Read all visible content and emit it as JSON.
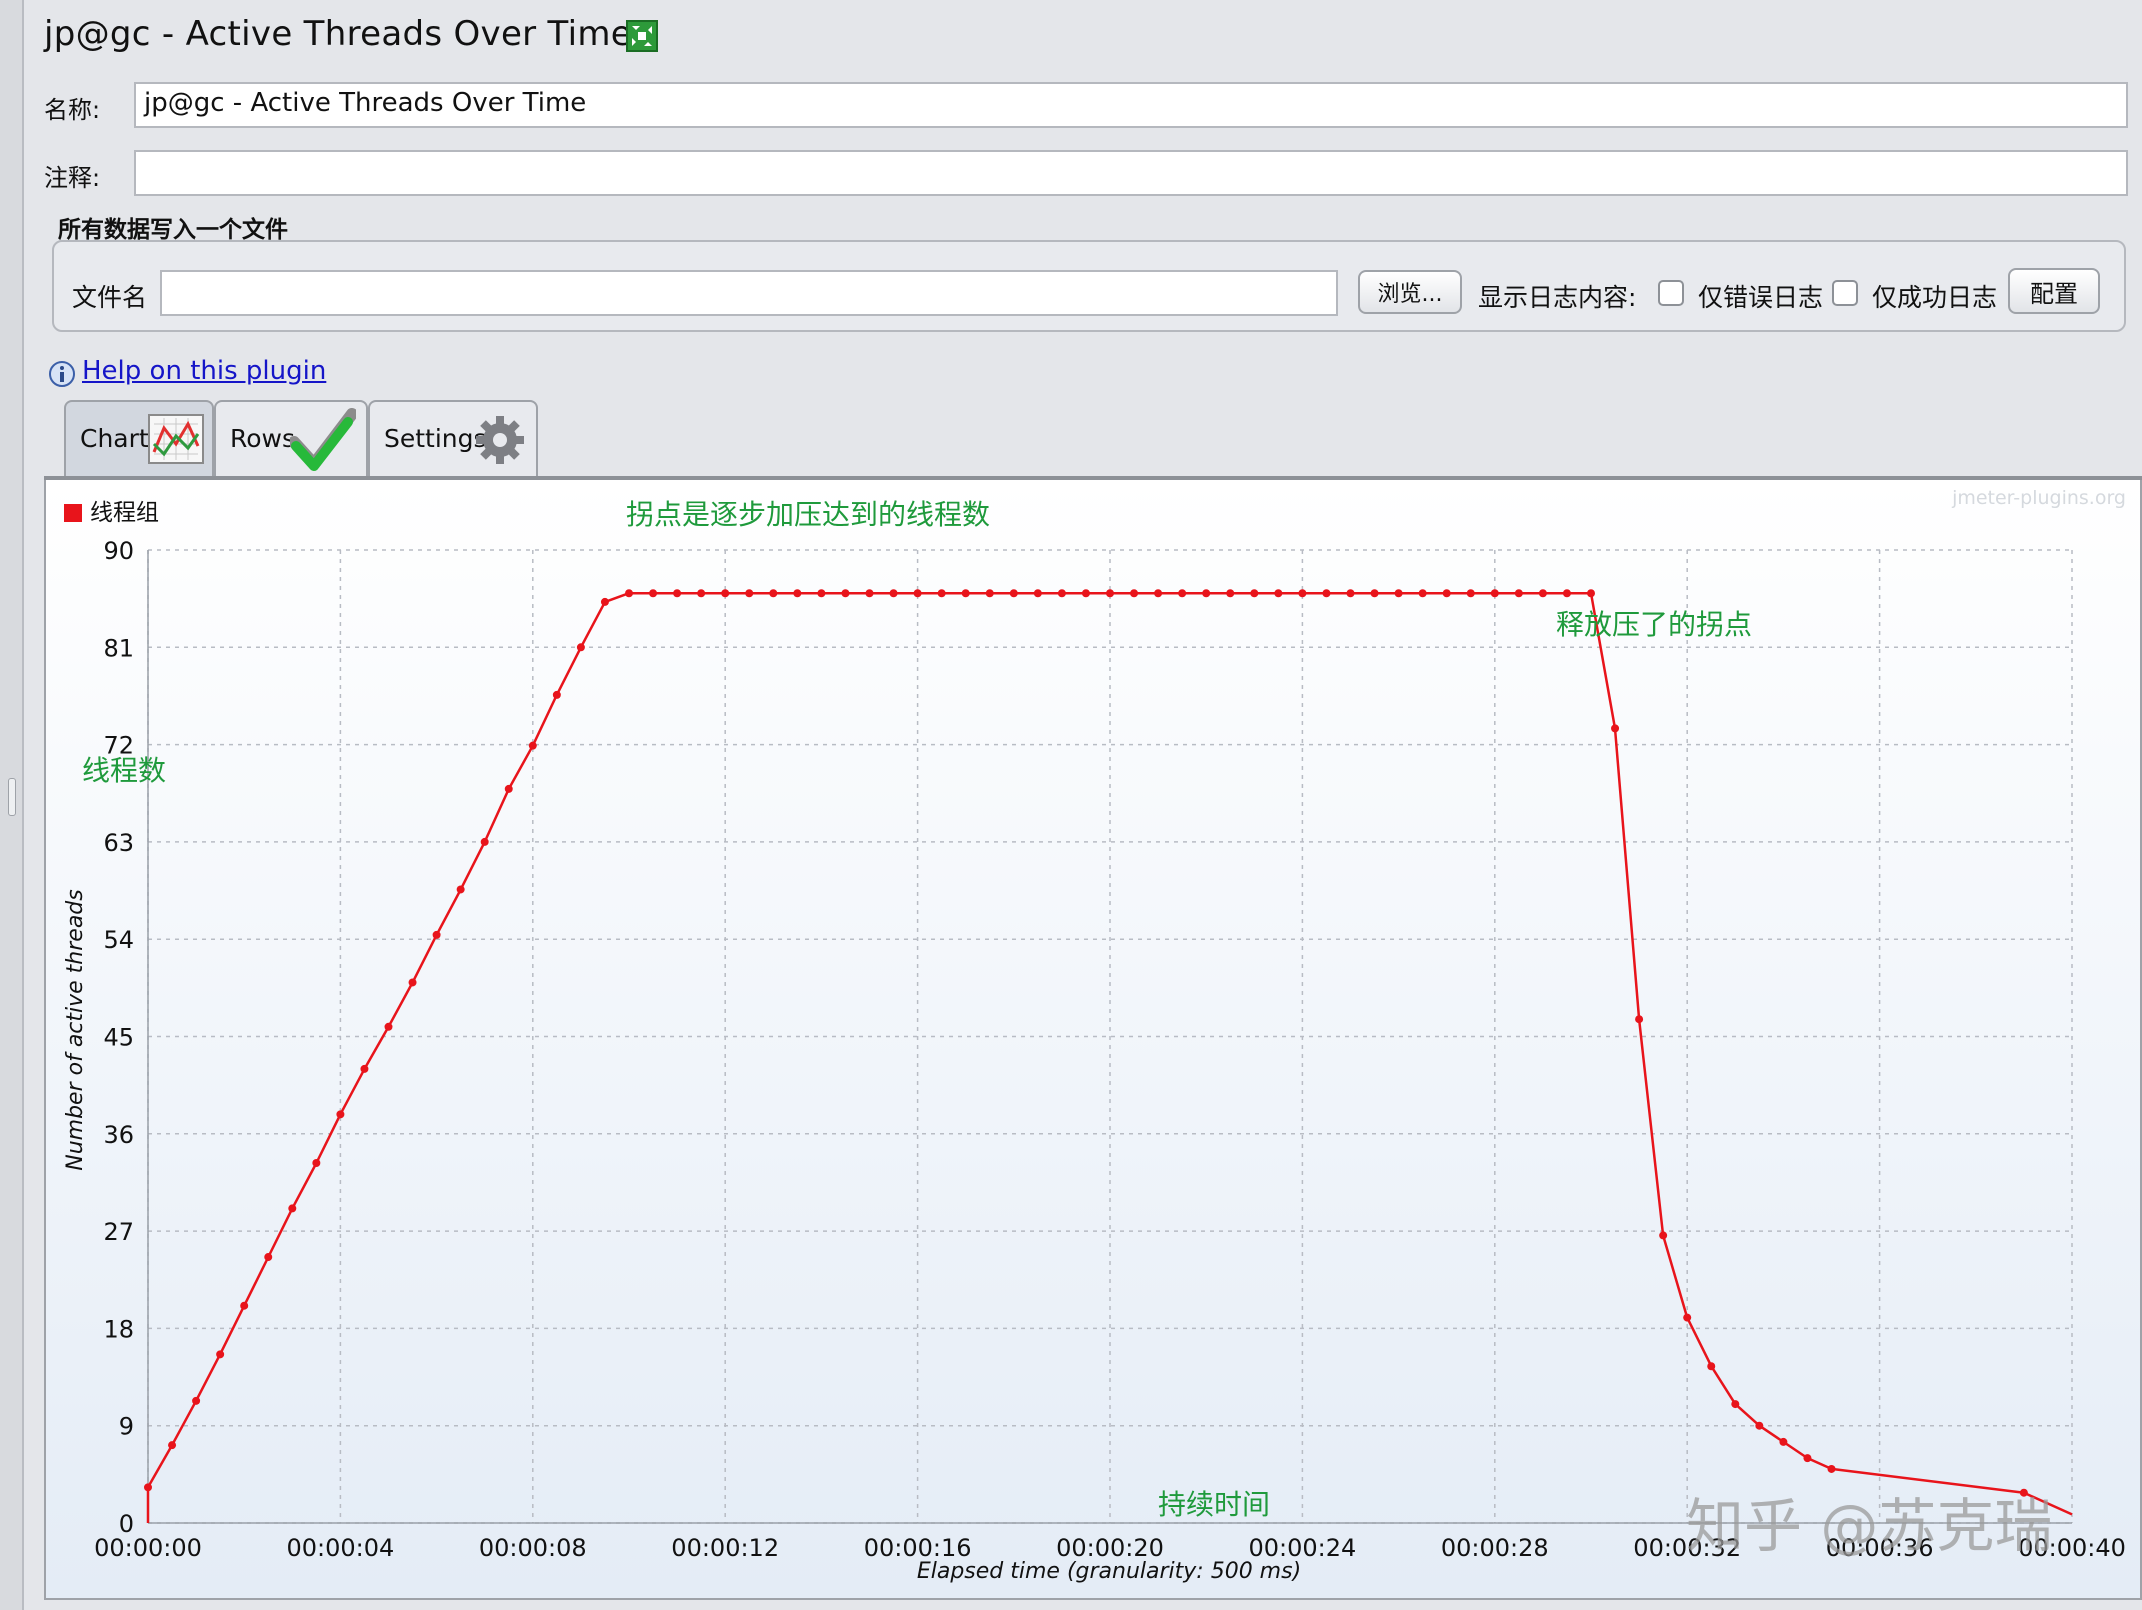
{
  "window": {
    "title": "jp@gc - Active Threads Over Time"
  },
  "form": {
    "name_label": "名称:",
    "name_value": "jp@gc - Active Threads Over Time",
    "comment_label": "注释:",
    "comment_value": ""
  },
  "file_group": {
    "title": "所有数据写入一个文件",
    "filename_label": "文件名",
    "filename_value": "",
    "browse_button": "浏览...",
    "log_display_label": "显示日志内容:",
    "errors_only_label": "仅错误日志",
    "errors_only_checked": false,
    "success_only_label": "仅成功日志",
    "success_only_checked": false,
    "configure_button": "配置"
  },
  "help": {
    "link_text": "Help on this plugin"
  },
  "tabs": [
    {
      "label": "Chart",
      "icon": "line-chart-icon",
      "active": true
    },
    {
      "label": "Rows",
      "icon": "checkmark-icon",
      "active": false
    },
    {
      "label": "Settings",
      "icon": "gear-icon",
      "active": false
    }
  ],
  "chart_data": {
    "type": "line",
    "watermark": "jmeter-plugins.org",
    "xlabel": "Elapsed time (granularity: 500 ms)",
    "ylabel": "Number of active threads",
    "ylim": [
      0,
      90
    ],
    "xlim": [
      0,
      40
    ],
    "grid": true,
    "legend_position": "top-left",
    "y_ticks": [
      "0",
      "9",
      "18",
      "27",
      "36",
      "45",
      "54",
      "63",
      "72",
      "81",
      "90"
    ],
    "x_ticks": [
      "00:00:00",
      "00:00:04",
      "00:00:08",
      "00:00:12",
      "00:00:16",
      "00:00:20",
      "00:00:24",
      "00:00:28",
      "00:00:32",
      "00:00:36",
      "00:00:40"
    ],
    "series": [
      {
        "name": "线程组",
        "color": "#e8141b",
        "x": [
          0,
          0.5,
          1,
          1.5,
          2,
          2.5,
          3,
          3.5,
          4,
          4.5,
          5,
          5.5,
          6,
          6.5,
          7,
          7.5,
          8,
          8.5,
          9,
          9.5,
          10,
          10.5,
          11,
          11.5,
          12,
          12.5,
          13,
          13.5,
          14,
          14.5,
          15,
          15.5,
          16,
          16.5,
          17,
          17.5,
          18,
          18.5,
          19,
          19.5,
          20,
          20.5,
          21,
          21.5,
          22,
          22.5,
          23,
          23.5,
          24,
          24.5,
          25,
          25.5,
          26,
          26.5,
          27,
          27.5,
          28,
          28.5,
          29,
          29.5,
          30,
          30.5,
          31,
          31.5,
          32,
          32.5,
          33,
          33.5,
          34,
          34.5,
          35,
          39
        ],
        "y": [
          3.3,
          7.2,
          11.3,
          15.6,
          20.1,
          24.6,
          29.1,
          33.3,
          37.8,
          42.0,
          45.9,
          50.0,
          54.4,
          58.6,
          63.0,
          67.9,
          71.9,
          76.6,
          81.0,
          85.2,
          86.0,
          86.0,
          86.0,
          86.0,
          86.0,
          86.0,
          86.0,
          86.0,
          86.0,
          86.0,
          86.0,
          86.0,
          86.0,
          86.0,
          86.0,
          86.0,
          86.0,
          86.0,
          86.0,
          86.0,
          86.0,
          86.0,
          86.0,
          86.0,
          86.0,
          86.0,
          86.0,
          86.0,
          86.0,
          86.0,
          86.0,
          86.0,
          86.0,
          86.0,
          86.0,
          86.0,
          86.0,
          86.0,
          86.0,
          86.0,
          86.0,
          73.5,
          46.6,
          26.6,
          19.0,
          14.5,
          11.0,
          9.0,
          7.5,
          6.0,
          5.0,
          2.8
        ]
      }
    ],
    "tail_end": {
      "x": 40,
      "y": 0.8
    },
    "annotations": [
      {
        "text": "拐点是逐步加压达到的线程数",
        "color": "#1f9a3c"
      },
      {
        "text": "释放压了的拐点",
        "color": "#1f9a3c"
      },
      {
        "text": "线程数",
        "color": "#1f9a3c"
      },
      {
        "text": "持续时间",
        "color": "#1f9a3c"
      },
      {
        "text": "知乎 @苏克瑞",
        "color": "#9a9a9a"
      }
    ]
  }
}
